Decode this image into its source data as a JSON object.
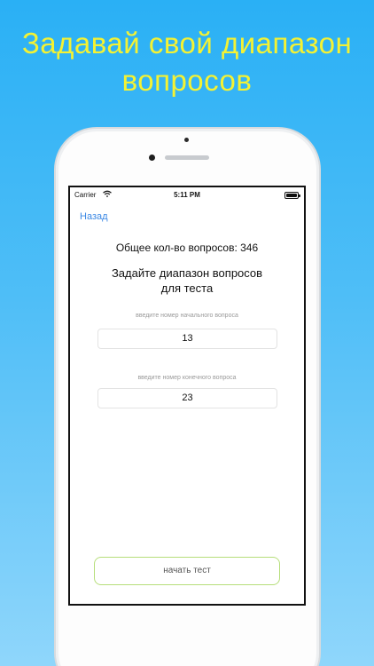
{
  "headline": {
    "line1": "Задавай свой диапазон",
    "line2": "вопросов"
  },
  "status_bar": {
    "carrier": "Carrier",
    "time": "5:11 PM",
    "wifi_icon": "wifi-icon",
    "battery_icon": "battery-icon"
  },
  "nav": {
    "back_label": "Назад"
  },
  "main": {
    "total_questions": "Общее кол-во вопросов: 346",
    "title_line1": "Задайте диапазон вопросов",
    "title_line2": "для теста",
    "start_field": {
      "hint": "введите номер начального вопроса",
      "value": "13"
    },
    "end_field": {
      "hint": "введите номер конечного вопроса",
      "value": "23"
    },
    "start_button_label": "начать тест"
  },
  "colors": {
    "background_top": "#2ab0f5",
    "background_bottom": "#8fd6fb",
    "headline": "#f4f233",
    "link": "#3b88e4",
    "button_border": "#b6de7a"
  }
}
